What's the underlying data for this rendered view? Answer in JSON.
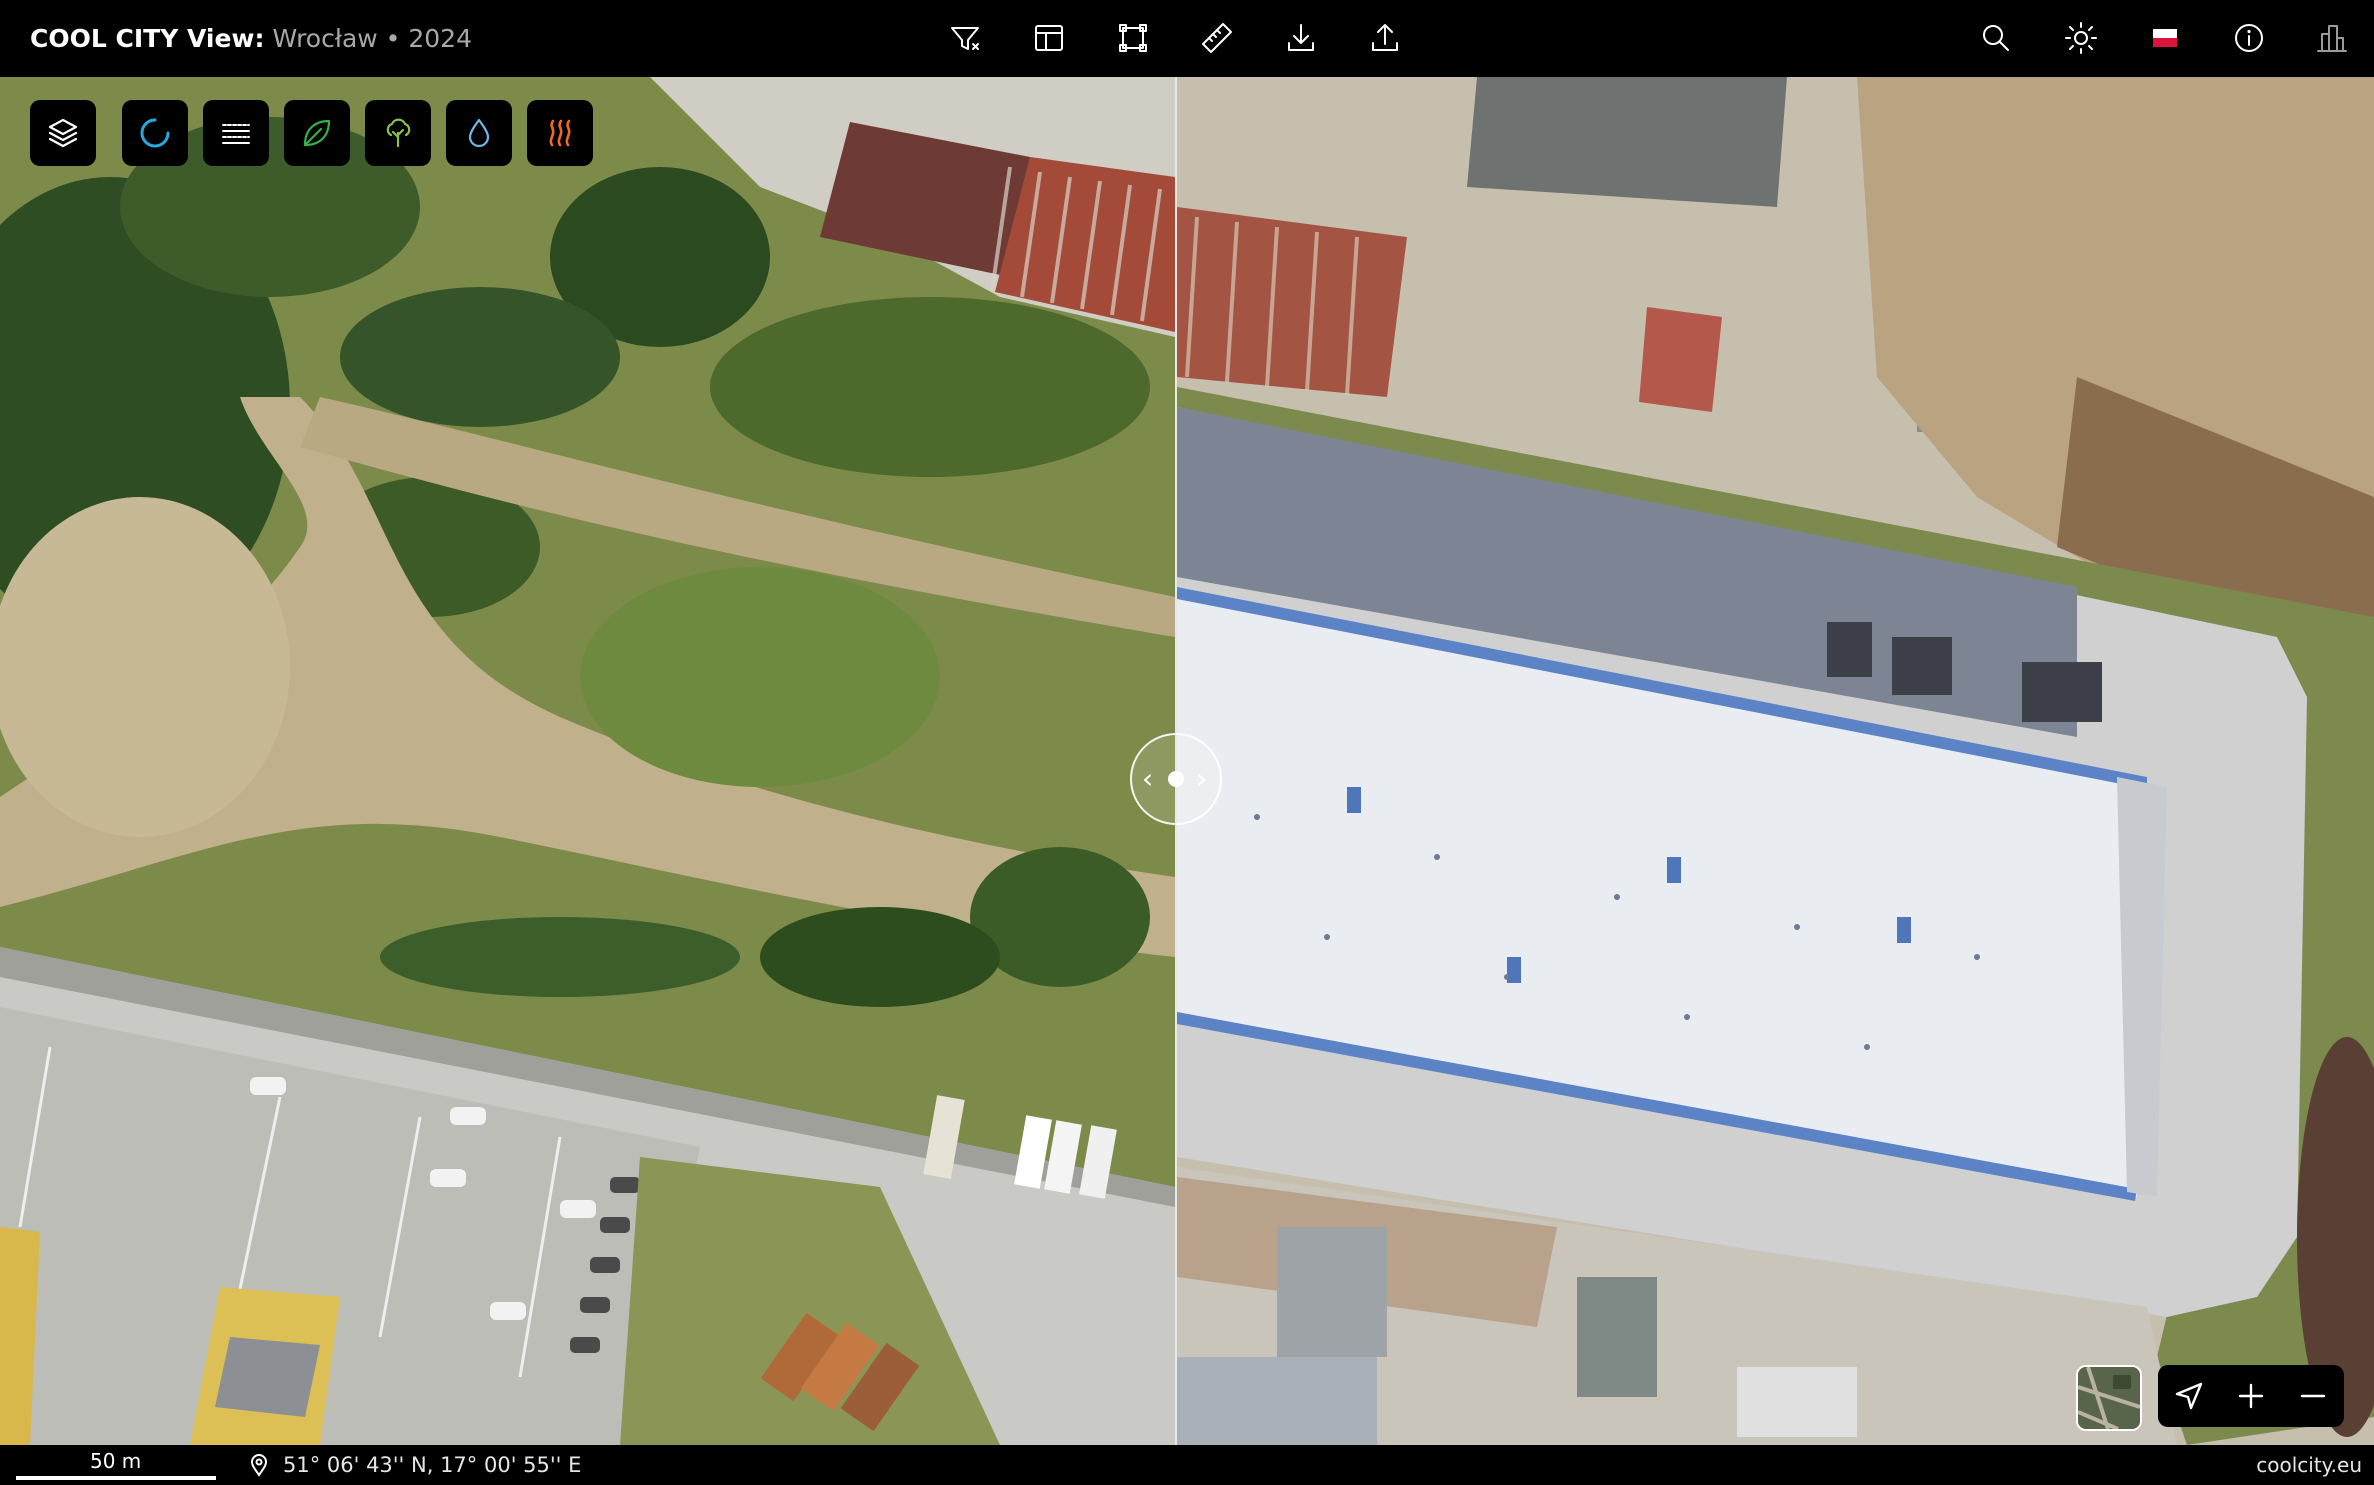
{
  "header": {
    "app_name": "COOL CITY View:",
    "location": "Wrocław • 2024"
  },
  "toolbar_center": [
    {
      "name": "filter-icon"
    },
    {
      "name": "layout-icon"
    },
    {
      "name": "area-select-icon"
    },
    {
      "name": "ruler-icon"
    },
    {
      "name": "download-icon"
    },
    {
      "name": "share-icon"
    }
  ],
  "toolbar_right": [
    {
      "name": "search-icon"
    },
    {
      "name": "brightness-icon"
    },
    {
      "name": "polish-flag-icon",
      "colors": [
        "#ffffff",
        "#dc143c"
      ]
    },
    {
      "name": "info-icon"
    },
    {
      "name": "buildings-icon"
    }
  ],
  "layer_buttons": [
    {
      "name": "layers-icon",
      "color": "#ffffff"
    },
    {
      "name": "loading-spinner-icon",
      "color": "#29a8e0"
    },
    {
      "name": "lines-icon",
      "color": "#ffffff"
    },
    {
      "name": "leaf-icon",
      "color": "#33b24a"
    },
    {
      "name": "tree-icon",
      "color": "#8bc34a"
    },
    {
      "name": "water-drop-icon",
      "color": "#6fb6e8"
    },
    {
      "name": "heat-icon",
      "color": "#f26a21"
    }
  ],
  "map_controls": [
    {
      "name": "locate-icon"
    },
    {
      "name": "zoom-in-icon"
    },
    {
      "name": "zoom-out-icon"
    }
  ],
  "status": {
    "scale_label": "50 m",
    "coordinates": "51° 06' 43'' N, 17° 00' 55'' E",
    "website": "coolcity.eu"
  }
}
